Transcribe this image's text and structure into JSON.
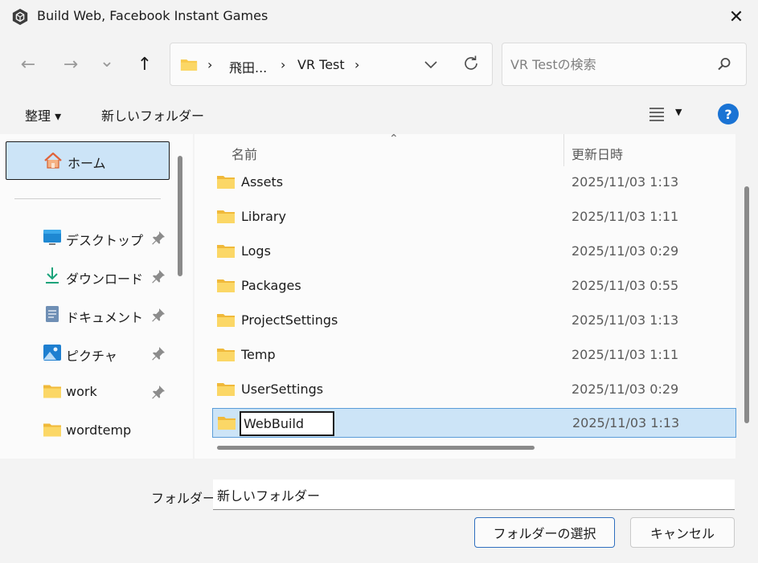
{
  "window": {
    "title": "Build Web, Facebook Instant Games",
    "icon": "unity-logo-icon",
    "close_glyph": "✕"
  },
  "navigation": {
    "back_glyph": "←",
    "forward_glyph": "→",
    "recent_glyph": "⌄",
    "up_glyph": "↑",
    "address": {
      "segments": [
        "飛田...",
        "VR Test"
      ],
      "separator": "›"
    },
    "search": {
      "placeholder": "VR Testの検索",
      "value": ""
    }
  },
  "commandbar": {
    "organize_label": "整理 ▾",
    "new_folder_label": "新しいフォルダー",
    "help_glyph": "?"
  },
  "sidebar": {
    "home_label": "ホーム",
    "items": [
      {
        "label": "デスクトップ",
        "icon": "desktop-icon",
        "pinned": true
      },
      {
        "label": "ダウンロード",
        "icon": "download-icon",
        "pinned": true
      },
      {
        "label": "ドキュメント",
        "icon": "document-icon",
        "pinned": true
      },
      {
        "label": "ピクチャ",
        "icon": "pictures-icon",
        "pinned": true
      },
      {
        "label": "work",
        "icon": "folder-icon",
        "pinned": true
      },
      {
        "label": "wordtemp",
        "icon": "folder-icon",
        "pinned": false
      }
    ]
  },
  "filelist": {
    "sort_glyph": "⌃",
    "columns": {
      "name": "名前",
      "modified": "更新日時"
    },
    "rows": [
      {
        "name": "Assets",
        "modified": "2025/11/03 1:13"
      },
      {
        "name": "Library",
        "modified": "2025/11/03 1:11"
      },
      {
        "name": "Logs",
        "modified": "2025/11/03 0:29"
      },
      {
        "name": "Packages",
        "modified": "2025/11/03 0:55"
      },
      {
        "name": "ProjectSettings",
        "modified": "2025/11/03 1:13"
      },
      {
        "name": "Temp",
        "modified": "2025/11/03 1:11"
      },
      {
        "name": "UserSettings",
        "modified": "2025/11/03 0:29"
      },
      {
        "name": "WebBuild",
        "modified": "2025/11/03 1:13",
        "selected": true,
        "renaming": true
      }
    ]
  },
  "footer": {
    "folder_label": "フォルダー:",
    "folder_value": "新しいフォルダー",
    "select_button": "フォルダーの選択",
    "cancel_button": "キャンセル"
  },
  "colors": {
    "selection": "#cce4f7",
    "folder": "#f8c94a",
    "accent": "#1a73d4"
  }
}
